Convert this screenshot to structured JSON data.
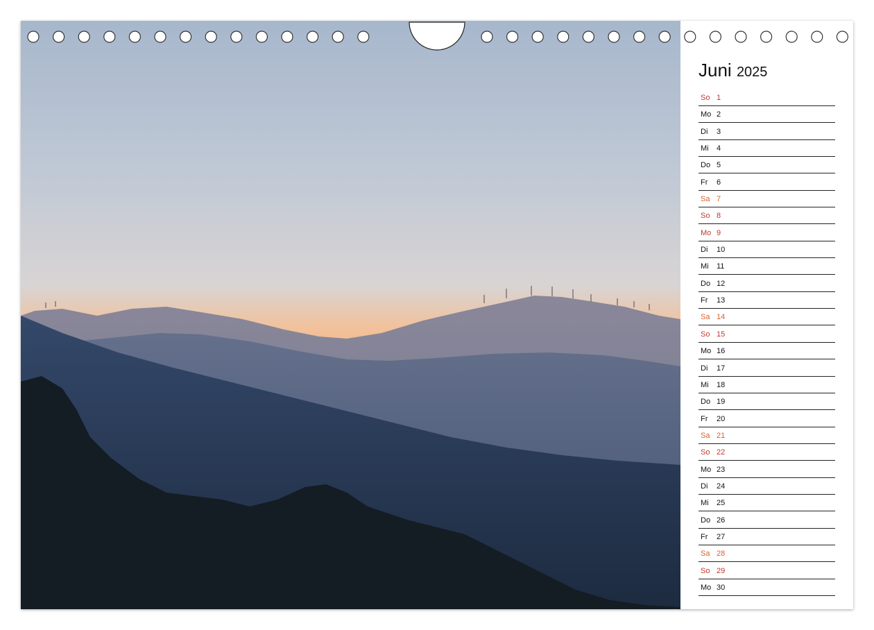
{
  "calendar": {
    "month": "Juni",
    "year": "2025",
    "days": [
      {
        "wd": "So",
        "num": "1",
        "type": "sunday"
      },
      {
        "wd": "Mo",
        "num": "2",
        "type": "weekday"
      },
      {
        "wd": "Di",
        "num": "3",
        "type": "weekday"
      },
      {
        "wd": "Mi",
        "num": "4",
        "type": "weekday"
      },
      {
        "wd": "Do",
        "num": "5",
        "type": "weekday"
      },
      {
        "wd": "Fr",
        "num": "6",
        "type": "weekday"
      },
      {
        "wd": "Sa",
        "num": "7",
        "type": "saturday"
      },
      {
        "wd": "So",
        "num": "8",
        "type": "sunday"
      },
      {
        "wd": "Mo",
        "num": "9",
        "type": "holiday"
      },
      {
        "wd": "Di",
        "num": "10",
        "type": "weekday"
      },
      {
        "wd": "Mi",
        "num": "11",
        "type": "weekday"
      },
      {
        "wd": "Do",
        "num": "12",
        "type": "weekday"
      },
      {
        "wd": "Fr",
        "num": "13",
        "type": "weekday"
      },
      {
        "wd": "Sa",
        "num": "14",
        "type": "saturday"
      },
      {
        "wd": "So",
        "num": "15",
        "type": "sunday"
      },
      {
        "wd": "Mo",
        "num": "16",
        "type": "weekday"
      },
      {
        "wd": "Di",
        "num": "17",
        "type": "weekday"
      },
      {
        "wd": "Mi",
        "num": "18",
        "type": "weekday"
      },
      {
        "wd": "Do",
        "num": "19",
        "type": "weekday"
      },
      {
        "wd": "Fr",
        "num": "20",
        "type": "weekday"
      },
      {
        "wd": "Sa",
        "num": "21",
        "type": "saturday"
      },
      {
        "wd": "So",
        "num": "22",
        "type": "sunday"
      },
      {
        "wd": "Mo",
        "num": "23",
        "type": "weekday"
      },
      {
        "wd": "Di",
        "num": "24",
        "type": "weekday"
      },
      {
        "wd": "Mi",
        "num": "25",
        "type": "weekday"
      },
      {
        "wd": "Do",
        "num": "26",
        "type": "weekday"
      },
      {
        "wd": "Fr",
        "num": "27",
        "type": "weekday"
      },
      {
        "wd": "Sa",
        "num": "28",
        "type": "saturday"
      },
      {
        "wd": "So",
        "num": "29",
        "type": "sunday"
      },
      {
        "wd": "Mo",
        "num": "30",
        "type": "weekday"
      }
    ]
  },
  "photo": {
    "subject": "mountain-ridge-sunset-icon",
    "colors": {
      "sky_top": "#a9b8cc",
      "sky_mid": "#d6d3d4",
      "sky_glow": "#f3b88a",
      "ridge_far": "#7f8195",
      "ridge_mid": "#5b6682",
      "ridge_near": "#2a3a55",
      "foreground": "#141c24"
    }
  }
}
